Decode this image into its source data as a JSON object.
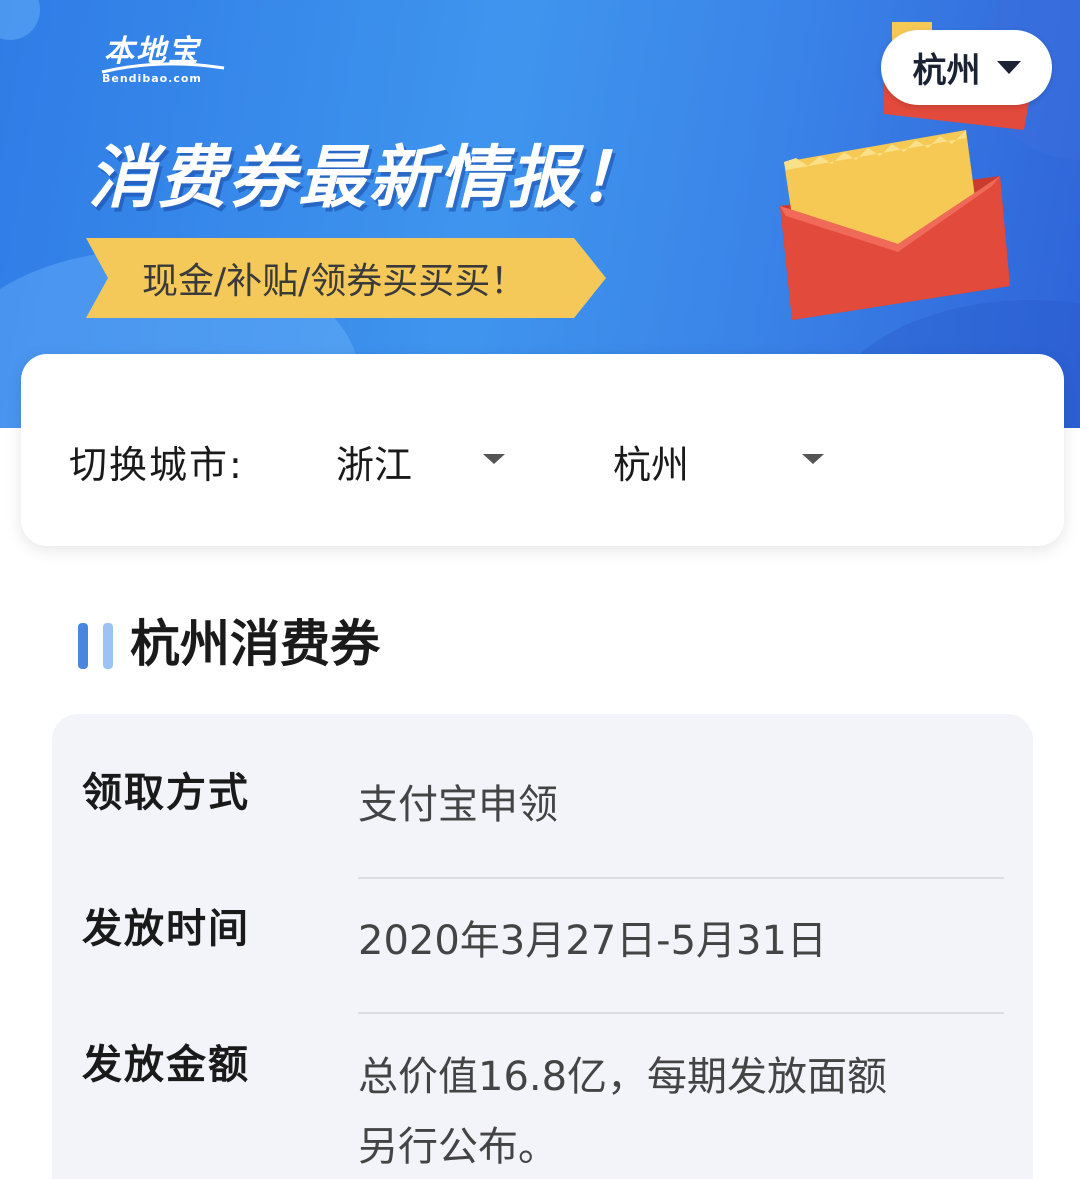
{
  "banner": {
    "logo_name": "本地宝",
    "logo_domain": "Bendibao.com",
    "headline": "消费券最新情报！",
    "ribbon_text": "现金/补贴/领券买买买！",
    "city_pill_label": "杭州",
    "colors": {
      "primary": "#3f95ee",
      "ribbon": "#f4c95a",
      "envelope": "#e24a3b",
      "letter": "#f6c955"
    }
  },
  "city_switch": {
    "label": "切换城市:",
    "province": "浙江",
    "city": "杭州"
  },
  "section": {
    "title": "杭州消费券"
  },
  "info": {
    "rows": [
      {
        "key": "领取方式",
        "value": "支付宝申领"
      },
      {
        "key": "发放时间",
        "value": "2020年3月27日-5月31日"
      },
      {
        "key": "发放金额",
        "value": "总价值16.8亿，每期发放面额",
        "value_line2": "另行公布。"
      }
    ]
  }
}
